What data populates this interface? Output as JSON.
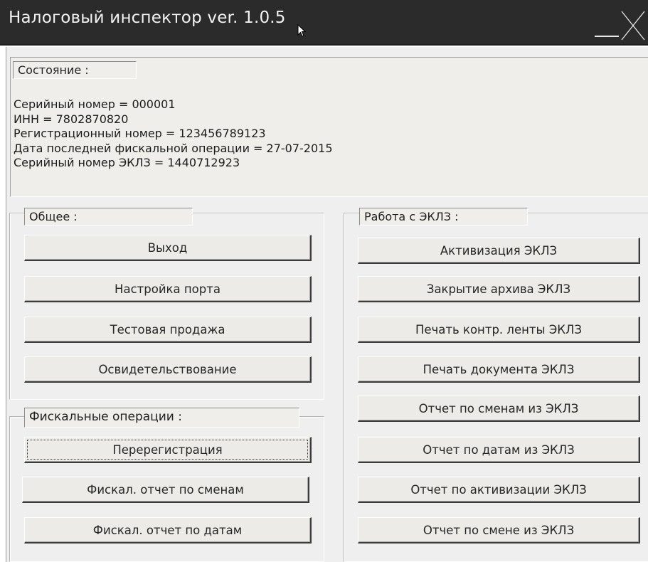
{
  "window": {
    "title": "Налоговый инспектор ver. 1.0.5"
  },
  "status": {
    "legend": "Состояние :",
    "lines": [
      "Серийный номер = 000001",
      "ИНН = 7802870820",
      "Регистрационный номер = 123456789123",
      "Дата последней фискальной операции = 27-07-2015",
      "Серийный номер ЭКЛЗ = 1440712923"
    ]
  },
  "general": {
    "legend": "Общее :",
    "buttons": [
      "Выход",
      "Настройка порта",
      "Тестовая продажа",
      "Освидетельствование"
    ]
  },
  "fiscal": {
    "legend": "Фискальные операции :",
    "buttons": [
      "Перерегистрация",
      "Фискал. отчет по сменам",
      "Фискал. отчет по датам"
    ]
  },
  "eklz": {
    "legend": "Работа с ЭКЛЗ :",
    "buttons": [
      "Активизация ЭКЛЗ",
      "Закрытие архива ЭКЛЗ",
      "Печать контр. ленты ЭКЛЗ",
      "Печать документа ЭКЛЗ",
      "Отчет по сменам из ЭКЛЗ",
      "Отчет по датам из ЭКЛЗ",
      "Отчет по активизации ЭКЛЗ",
      "Отчет по смене из ЭКЛЗ"
    ]
  },
  "icons": {
    "cursor": "mouse-pointer-icon",
    "minimize": "minimize-icon",
    "close": "close-icon"
  }
}
